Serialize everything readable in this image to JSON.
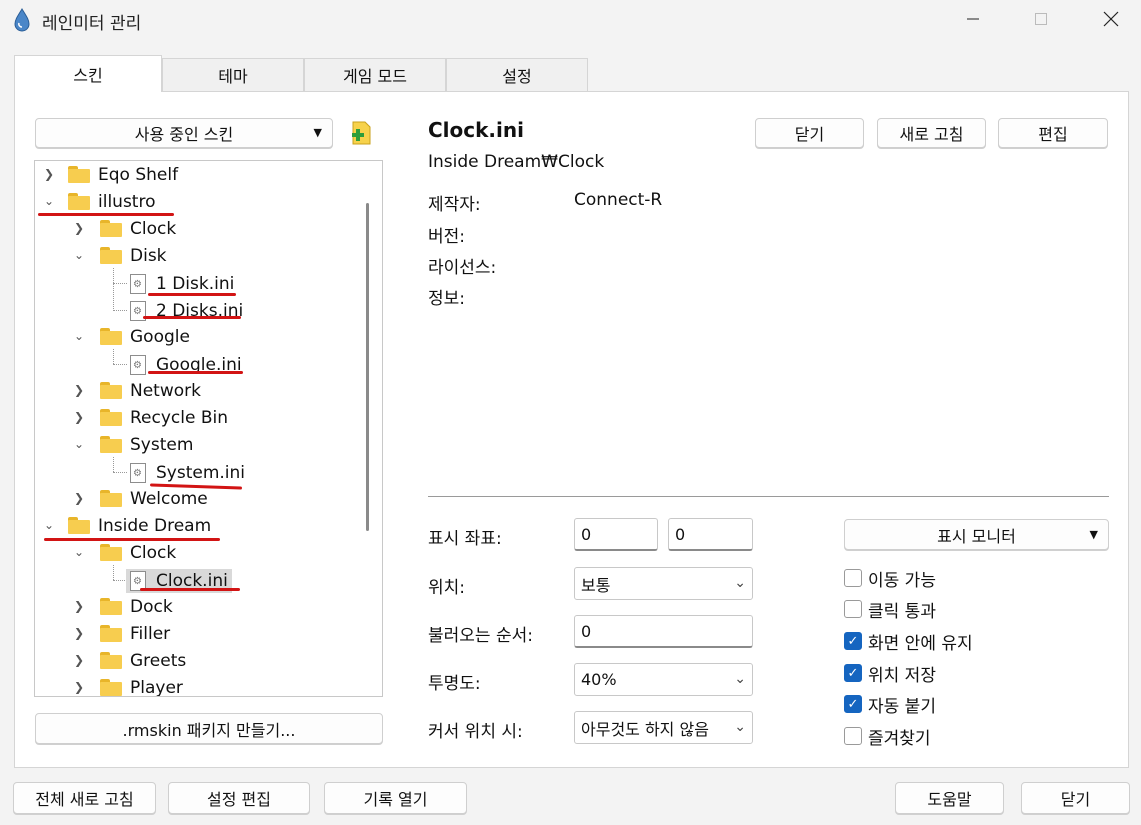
{
  "window": {
    "title": "레인미터 관리",
    "icon": "raindrop-icon",
    "controls": [
      "minimize-icon",
      "maximize-icon",
      "close-icon"
    ]
  },
  "tabs": [
    {
      "label": "스킨",
      "active": true
    },
    {
      "label": "테마",
      "active": false
    },
    {
      "label": "게임 모드",
      "active": false
    },
    {
      "label": "설정",
      "active": false
    }
  ],
  "skins_panel": {
    "active_skins_dropdown": "사용 중인 스킨",
    "add_icon": "add-skin-icon",
    "tree": [
      {
        "label": "Eqo Shelf",
        "type": "folder",
        "expanded": false
      },
      {
        "label": "illustro",
        "type": "folder",
        "expanded": true
      },
      {
        "label": "Clock",
        "type": "folder",
        "expanded": false
      },
      {
        "label": "Disk",
        "type": "folder",
        "expanded": true
      },
      {
        "label": "1 Disk.ini",
        "type": "file"
      },
      {
        "label": "2 Disks.ini",
        "type": "file"
      },
      {
        "label": "Google",
        "type": "folder",
        "expanded": true
      },
      {
        "label": "Google.ini",
        "type": "file"
      },
      {
        "label": "Network",
        "type": "folder",
        "expanded": false
      },
      {
        "label": "Recycle Bin",
        "type": "folder",
        "expanded": false
      },
      {
        "label": "System",
        "type": "folder",
        "expanded": true
      },
      {
        "label": "System.ini",
        "type": "file"
      },
      {
        "label": "Welcome",
        "type": "folder",
        "expanded": false
      },
      {
        "label": "Inside Dream",
        "type": "folder",
        "expanded": true
      },
      {
        "label": "Clock",
        "type": "folder",
        "expanded": true
      },
      {
        "label": "Clock.ini",
        "type": "file",
        "selected": true
      },
      {
        "label": "Dock",
        "type": "folder",
        "expanded": false
      },
      {
        "label": "Filler",
        "type": "folder",
        "expanded": false
      },
      {
        "label": "Greets",
        "type": "folder",
        "expanded": false
      },
      {
        "label": "Player",
        "type": "folder",
        "expanded": false
      }
    ],
    "rmskin_button": ".rmskin 패키지 만들기..."
  },
  "details": {
    "title": "Clock.ini",
    "path": "Inside Dream₩Clock",
    "buttons": {
      "unload": "닫기",
      "refresh": "새로 고침",
      "edit": "편집"
    },
    "meta": {
      "author_label": "제작자:",
      "author_value": "Connect-R",
      "version_label": "버전:",
      "license_label": "라이선스:",
      "info_label": "정보:"
    }
  },
  "settings": {
    "coords_label": "표시 좌표:",
    "coord_x": "0",
    "coord_y": "0",
    "monitor_dropdown": "표시 모니터",
    "position_label": "위치:",
    "position_value": "보통",
    "load_order_label": "불러오는 순서:",
    "load_order_value": "0",
    "transparency_label": "투명도:",
    "transparency_value": "40%",
    "on_hover_label": "커서 위치 시:",
    "on_hover_value": "아무것도 하지 않음",
    "checkboxes": [
      {
        "label": "이동 가능",
        "checked": false
      },
      {
        "label": "클릭 통과",
        "checked": false
      },
      {
        "label": "화면 안에 유지",
        "checked": true
      },
      {
        "label": "위치 저장",
        "checked": true
      },
      {
        "label": "자동 붙기",
        "checked": true
      },
      {
        "label": "즐겨찾기",
        "checked": false
      }
    ]
  },
  "footer": {
    "refresh_all": "전체 새로 고침",
    "edit_settings": "설정 편집",
    "open_log": "기록 열기",
    "help": "도움말",
    "close": "닫기"
  },
  "colors": {
    "annotation_red": "#d21414",
    "checkbox_blue": "#1565c0"
  }
}
